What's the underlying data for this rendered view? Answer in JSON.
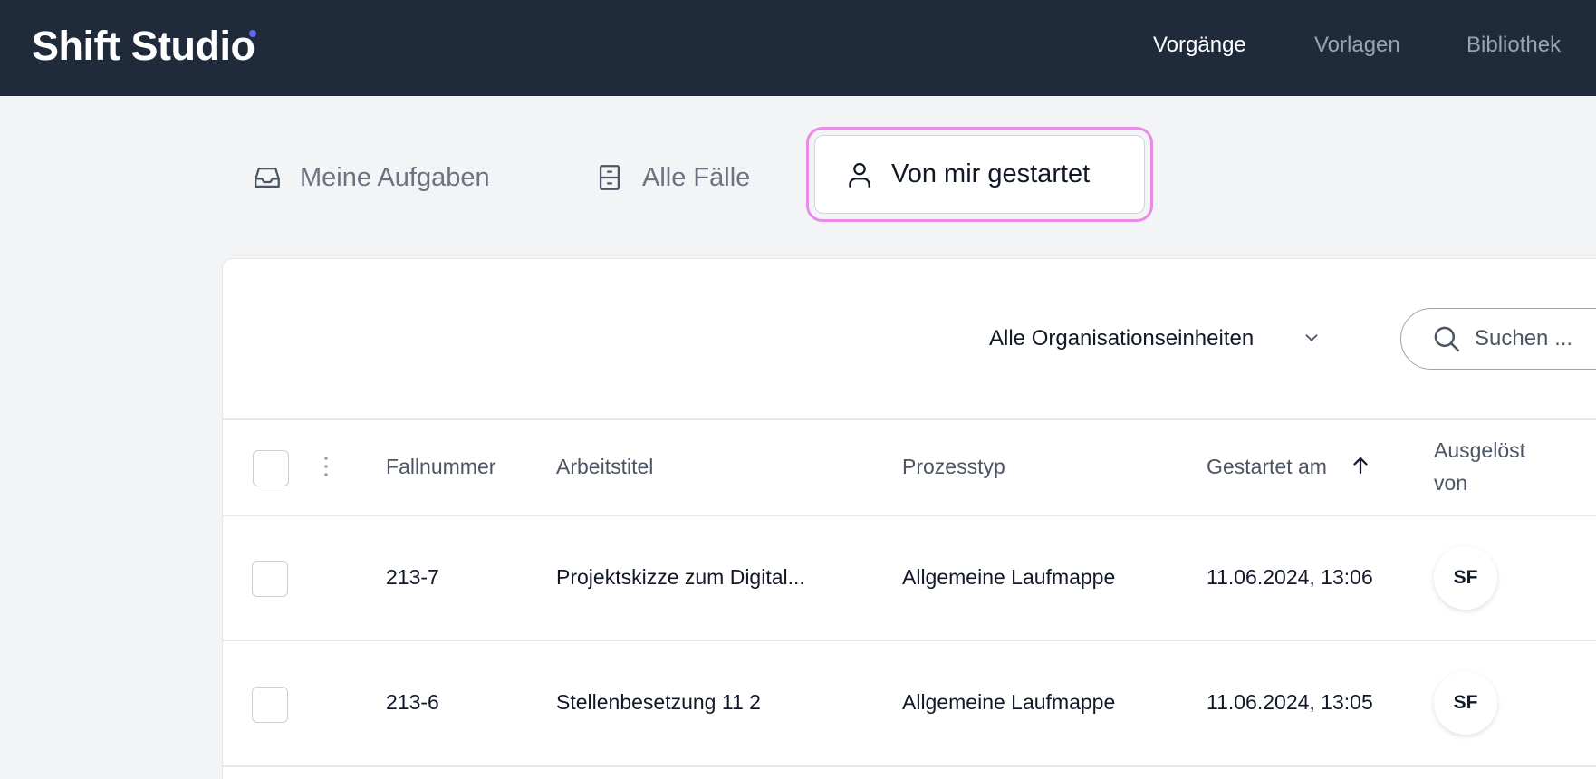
{
  "app": {
    "title": "Shift Studio",
    "accent_color": "#6366f1"
  },
  "topnav": {
    "items": [
      {
        "label": "Vorgänge",
        "active": true
      },
      {
        "label": "Vorlagen",
        "active": false
      },
      {
        "label": "Bibliothek",
        "active": false
      }
    ]
  },
  "tabs": [
    {
      "label": "Meine Aufgaben",
      "icon": "inbox-icon",
      "active": false
    },
    {
      "label": "Alle Fälle",
      "icon": "archive-icon",
      "active": false
    },
    {
      "label": "Von mir gestartet",
      "icon": "user-icon",
      "active": true
    }
  ],
  "toolbar": {
    "filter_label": "Alle Organisationseinheiten",
    "search_placeholder": "Suchen ..."
  },
  "table": {
    "columns": [
      "Fallnummer",
      "Arbeitstitel",
      "Prozesstyp",
      "Gestartet am",
      "Ausgelöst",
      "von"
    ],
    "sort_column": "Gestartet am",
    "sort_direction": "ascending",
    "rows": [
      {
        "fallnummer": "213-7",
        "arbeitstitel": "Projektskizze zum Digital...",
        "prozesstyp": "Allgemeine Laufmappe",
        "gestartet_am": "11.06.2024, 13:06",
        "ausgeloest_von": "SF"
      },
      {
        "fallnummer": "213-6",
        "arbeitstitel": "Stellenbesetzung 11 2",
        "prozesstyp": "Allgemeine Laufmappe",
        "gestartet_am": "11.06.2024, 13:05",
        "ausgeloest_von": "SF"
      }
    ]
  }
}
